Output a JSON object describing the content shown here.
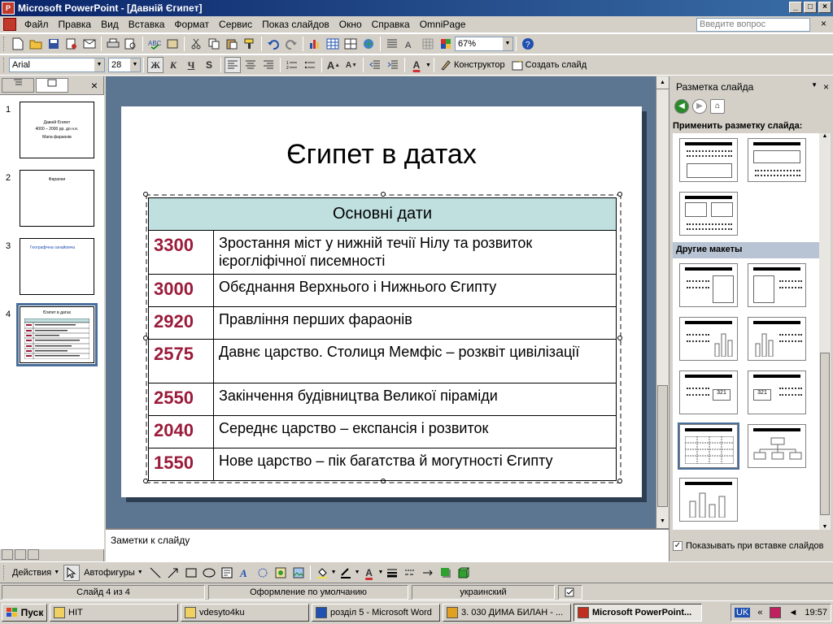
{
  "window": {
    "title": "Microsoft PowerPoint - [Давній Єгипет]",
    "controls": [
      "_",
      "□",
      "×"
    ]
  },
  "menu": {
    "items": [
      "Файл",
      "Правка",
      "Вид",
      "Вставка",
      "Формат",
      "Сервис",
      "Показ слайдов",
      "Окно",
      "Справка",
      "OmniPage"
    ],
    "help_placeholder": "Введите вопрос",
    "close_glyph": "×"
  },
  "toolbar_standard": {
    "zoom": "67%"
  },
  "toolbar_format": {
    "font": "Arial",
    "size": "28",
    "bold": "Ж",
    "italic": "К",
    "underline": "Ч",
    "shadow": "S",
    "designer": "Конструктор",
    "new_slide": "Создать слайд"
  },
  "left_panel": {
    "close_glyph": "×",
    "slides": [
      {
        "num": "1",
        "title": "Давній Єгипет",
        "subtitle": "4000 – 2000 рр. до н.е.",
        "extra": "Мапа фараонів"
      },
      {
        "num": "2",
        "title": "Фараони"
      },
      {
        "num": "3",
        "title": "Географічна ознайомча"
      },
      {
        "num": "4",
        "title": "Єгипет в датах"
      }
    ]
  },
  "slide": {
    "title": "Єгипет в датах",
    "table_header": "Основні дати",
    "rows": [
      {
        "year": "3300",
        "event": "Зростання міст у нижній течії Нілу та розвиток ієрогліфічної писемності"
      },
      {
        "year": "3000",
        "event": "Обєднання Верхнього і Нижнього Єгипту"
      },
      {
        "year": "2920",
        "event": "Правління перших фараонів"
      },
      {
        "year": "2575",
        "event": "Давнє царство. Столиця Мемфіс – розквіт цивілізації"
      },
      {
        "year": "2550",
        "event": "Закінчення будівництва Великої піраміди"
      },
      {
        "year": "2040",
        "event": "Середнє царство – експансія і розвиток"
      },
      {
        "year": "1550",
        "event": "Нове царство – пік багатства й могутності Єгипту"
      }
    ]
  },
  "notes": {
    "placeholder": "Заметки к слайду"
  },
  "task_pane": {
    "title": "Разметка слайда",
    "close_glyph": "×",
    "apply_label": "Применить разметку слайда:",
    "other_label": "Другие макеты",
    "show_label": "Показывать при вставке слайдов",
    "chart_label": "321"
  },
  "drawing": {
    "actions": "Действия",
    "autoshapes": "Автофигуры"
  },
  "status": {
    "slide": "Слайд 4 из 4",
    "design": "Оформление по умолчанию",
    "language": "украинский"
  },
  "taskbar": {
    "start": "Пуск",
    "tasks": [
      "НІТ",
      "vdesyto4ku",
      "розділ 5 - Microsoft Word",
      "3. 030 ДИМА БИЛАН - ...",
      "Microsoft PowerPoint..."
    ],
    "lang": "UK",
    "clock": "19:57"
  }
}
